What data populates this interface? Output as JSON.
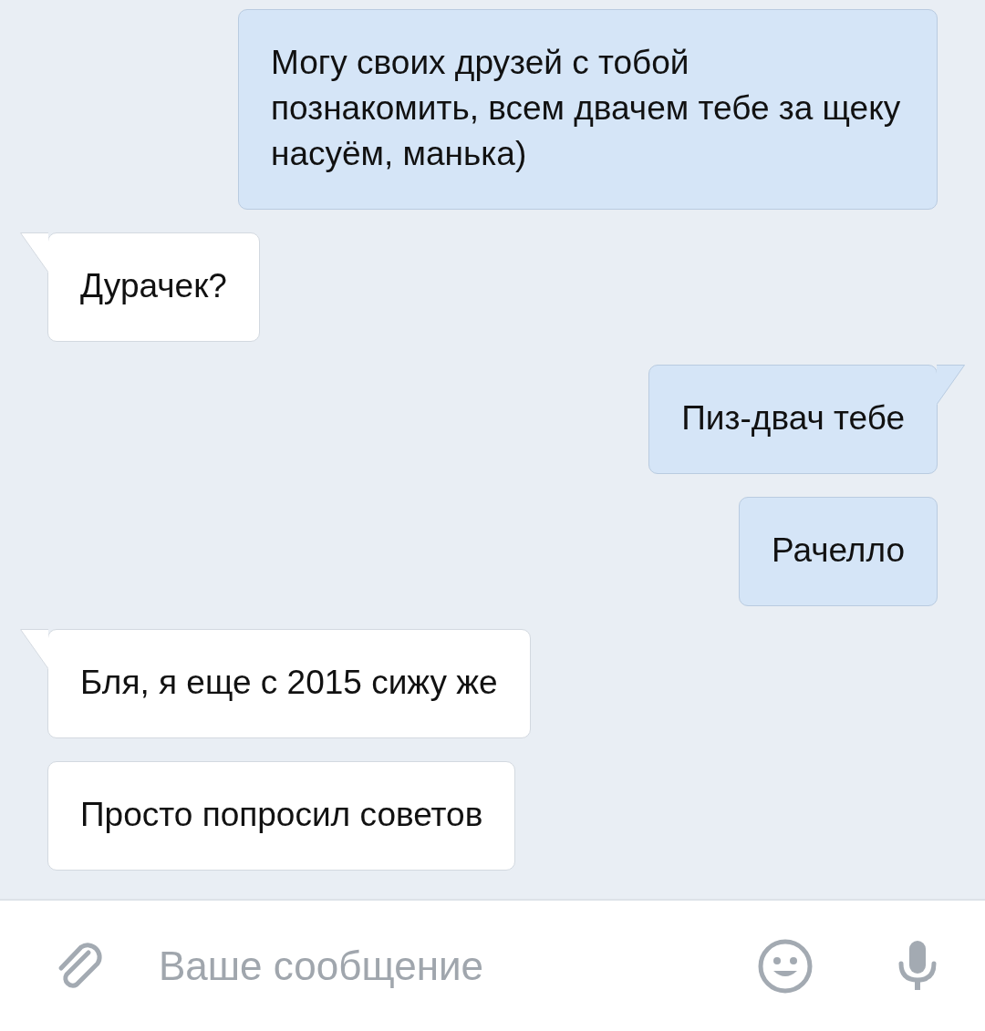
{
  "messages": [
    {
      "kind": "outgoing",
      "tail": false,
      "text": "Могу своих друзей с тобой познакомить, всем двачем тебе за щеку насуём, манька)"
    },
    {
      "kind": "incoming",
      "tail": true,
      "text": "Дурачек?"
    },
    {
      "kind": "outgoing",
      "tail": true,
      "text": "Пиз-двач тебе"
    },
    {
      "kind": "outgoing",
      "tail": false,
      "text": "Рачелло"
    },
    {
      "kind": "incoming",
      "tail": true,
      "text": "Бля, я еще с 2015 сижу же"
    },
    {
      "kind": "incoming",
      "tail": false,
      "text": "Просто попросил советов"
    }
  ],
  "composer": {
    "placeholder": "Ваше сообщение"
  }
}
